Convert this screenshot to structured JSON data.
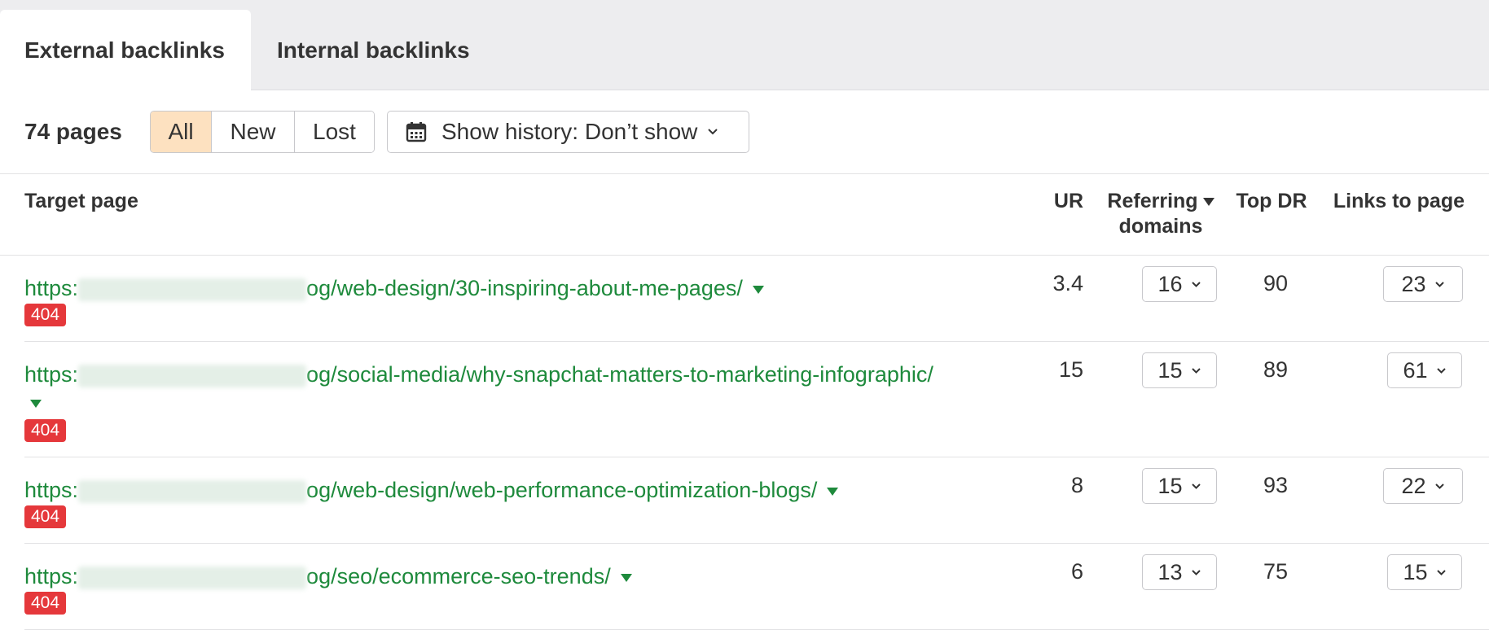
{
  "tabs": [
    {
      "label": "External backlinks",
      "active": true
    },
    {
      "label": "Internal backlinks",
      "active": false
    }
  ],
  "toolbar": {
    "pages_count": "74 pages",
    "filters": [
      {
        "label": "All",
        "active": true
      },
      {
        "label": "New",
        "active": false
      },
      {
        "label": "Lost",
        "active": false
      }
    ],
    "history_label": "Show history: Don’t show"
  },
  "table": {
    "headers": {
      "target": "Target page",
      "ur": "UR",
      "referring_line1": "Referring",
      "referring_line2": "domains",
      "top_dr": "Top DR",
      "links": "Links to page"
    },
    "rows": [
      {
        "url_prefix": "https:",
        "url_path": "og/web-design/30-inspiring-about-me-pages/",
        "status": "404",
        "ur": "3.4",
        "referring": "16",
        "top_dr": "90",
        "links": "23"
      },
      {
        "url_prefix": "https:",
        "url_path": "og/social-media/why-snapchat-matters-to-marketing-infographic/",
        "status": "404",
        "ur": "15",
        "referring": "15",
        "top_dr": "89",
        "links": "61"
      },
      {
        "url_prefix": "https:",
        "url_path": "og/web-design/web-performance-optimization-blogs/",
        "status": "404",
        "ur": "8",
        "referring": "15",
        "top_dr": "93",
        "links": "22"
      },
      {
        "url_prefix": "https:",
        "url_path": "og/seo/ecommerce-seo-trends/",
        "status": "404",
        "ur": "6",
        "referring": "13",
        "top_dr": "75",
        "links": "15"
      }
    ]
  }
}
